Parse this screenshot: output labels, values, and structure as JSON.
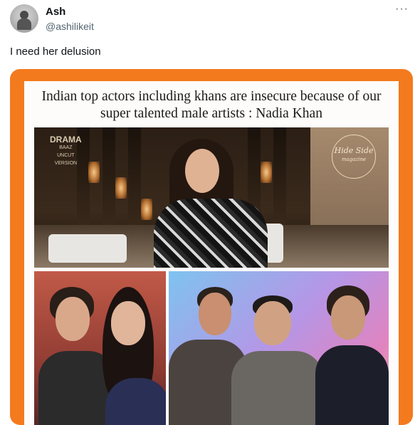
{
  "tweet": {
    "display_name": "Ash",
    "handle": "@ashilikeit",
    "more_icon": "···",
    "text": "I need her delusion"
  },
  "media": {
    "headline": "Indian top actors including khans are insecure because of our super talented male artists : Nadia Khan",
    "logos": {
      "drama": "DRAMA",
      "drama_sub": "BAAZ",
      "uncut": "UNCUT",
      "version": "VERSION",
      "hideside": "Hide Side",
      "magazine": "magazine"
    }
  },
  "colors": {
    "accent_frame": "#f47a1e",
    "text_primary": "#0f1419",
    "text_secondary": "#536471"
  }
}
